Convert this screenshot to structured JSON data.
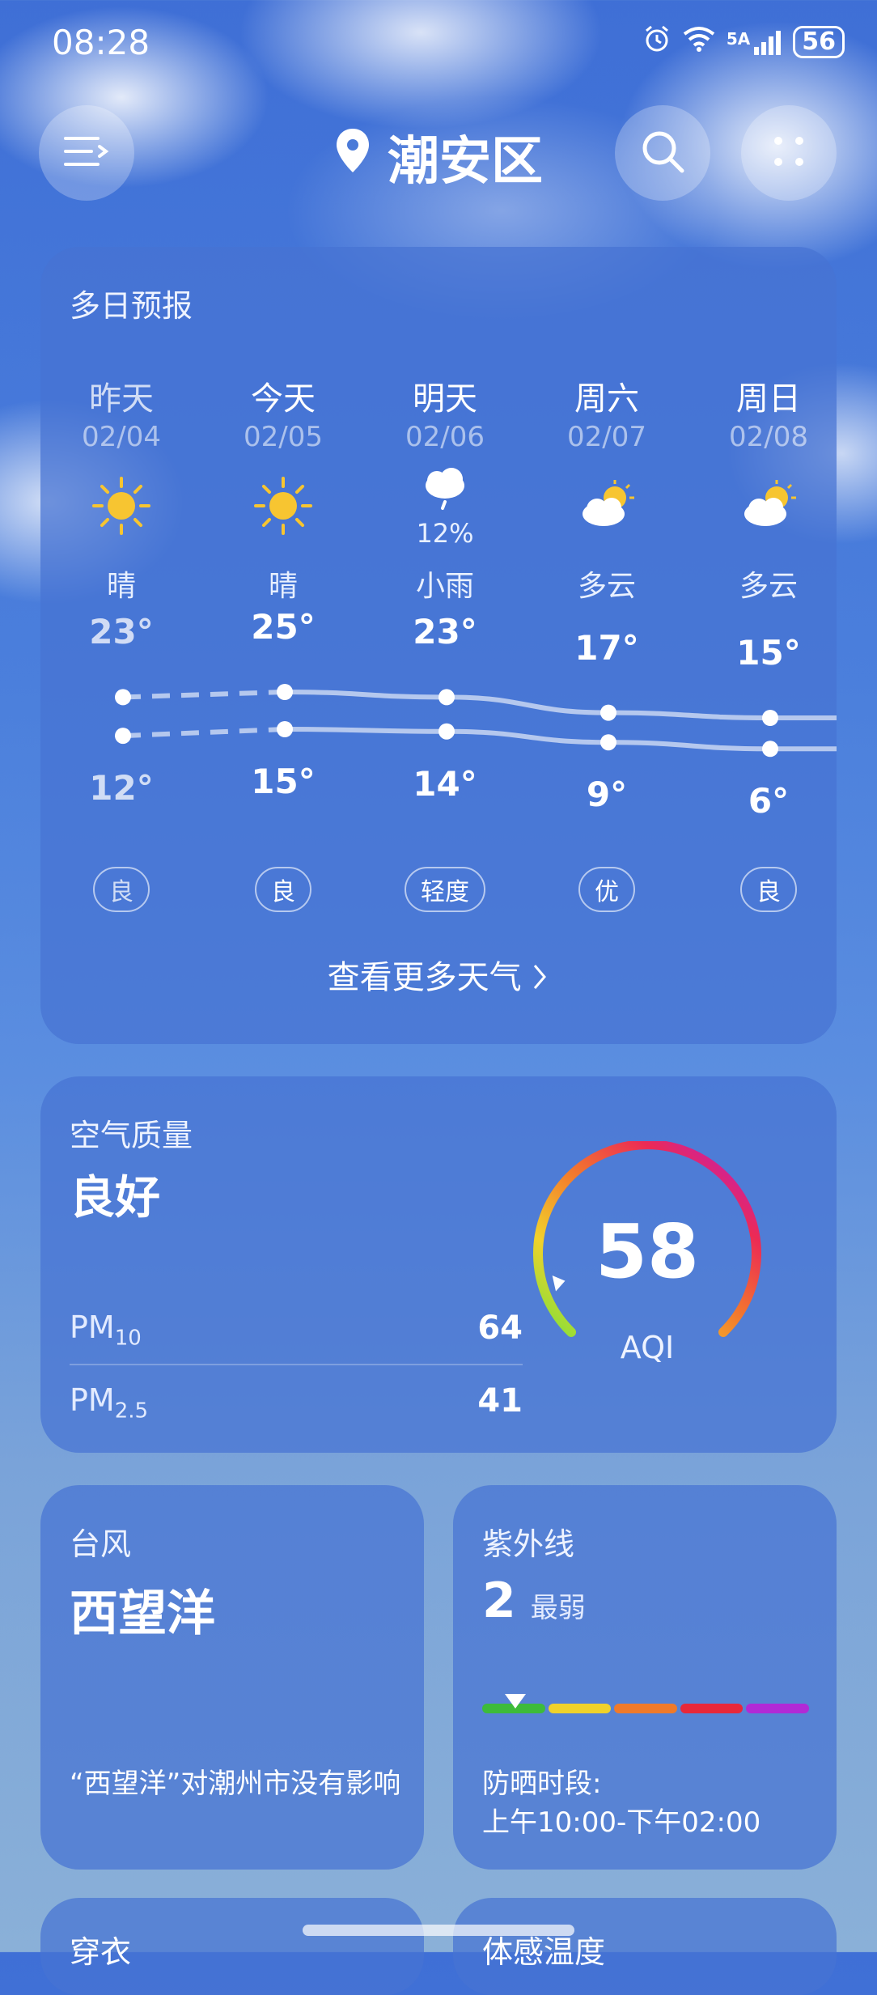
{
  "status_bar": {
    "time": "08:28",
    "network": "5A",
    "battery": "56"
  },
  "header": {
    "city": "潮安区"
  },
  "forecast": {
    "title": "多日预报",
    "days": [
      {
        "name": "昨天",
        "date": "02/04",
        "icon": "sun-icon",
        "condition": "晴",
        "high": "23°",
        "low": "12°",
        "aqi": "良",
        "precip": ""
      },
      {
        "name": "今天",
        "date": "02/05",
        "icon": "sun-icon",
        "condition": "晴",
        "high": "25°",
        "low": "15°",
        "aqi": "良",
        "precip": ""
      },
      {
        "name": "明天",
        "date": "02/06",
        "icon": "light-rain-icon",
        "condition": "小雨",
        "high": "23°",
        "low": "14°",
        "aqi": "轻度",
        "precip": "12%"
      },
      {
        "name": "周六",
        "date": "02/07",
        "icon": "partly-cloudy-icon",
        "condition": "多云",
        "high": "17°",
        "low": "9°",
        "aqi": "优",
        "precip": ""
      },
      {
        "name": "周日",
        "date": "02/08",
        "icon": "partly-cloudy-icon",
        "condition": "多云",
        "high": "15°",
        "low": "6°",
        "aqi": "良",
        "precip": ""
      }
    ],
    "more_label": "查看更多天气"
  },
  "chart_data": {
    "type": "line",
    "categories": [
      "昨天",
      "今天",
      "明天",
      "周六",
      "周日"
    ],
    "series": [
      {
        "values": [
          23,
          25,
          23,
          17,
          15
        ]
      },
      {
        "values": [
          12,
          15,
          14,
          9,
          6
        ]
      }
    ]
  },
  "air_quality": {
    "title": "空气质量",
    "level": "良好",
    "pm10_label": "PM",
    "pm10_sub": "10",
    "pm10_value": "64",
    "pm25_label": "PM",
    "pm25_sub": "2.5",
    "pm25_value": "41",
    "aqi": "58",
    "aqi_label": "AQI",
    "aqi_fraction": 0.12
  },
  "typhoon": {
    "title": "台风",
    "name": "西望洋",
    "note": "“西望洋”对潮州市没有影响"
  },
  "uv": {
    "title": "紫外线",
    "index": "2",
    "level": "最弱",
    "protect_label": "防晒时段:",
    "protect_time": "上午10:00-下午02:00",
    "scale_colors": [
      "#3dbb3a",
      "#f0d22a",
      "#f07a2a",
      "#e8283a",
      "#b12ad6"
    ]
  },
  "next_cards": [
    "穿衣",
    "体感温度"
  ],
  "colors": {
    "card_bg": "#4673d2",
    "sun": "#f7c531"
  }
}
